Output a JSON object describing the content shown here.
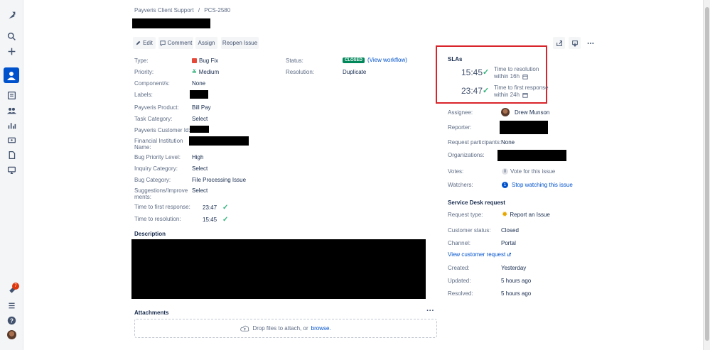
{
  "breadcrumb": {
    "project": "Payveris Client Support",
    "separator": "/",
    "issue_key": "PCS-2580"
  },
  "toolbar": {
    "edit": "Edit",
    "comment": "Comment",
    "assign": "Assign",
    "reopen": "Reopen Issue"
  },
  "details": [
    {
      "label": "Type:",
      "value": "Bug Fix"
    },
    {
      "label": "Priority:",
      "value": "Medium"
    },
    {
      "label": "Component/s:",
      "value": "None"
    },
    {
      "label": "Labels:",
      "value": ""
    },
    {
      "label": "Payveris Product:",
      "value": "Bill Pay"
    },
    {
      "label": "Task Category:",
      "value": "Select"
    },
    {
      "label": "Payveris Customer Id:",
      "value": ""
    },
    {
      "label": "Financial Institution Name:",
      "value": ""
    },
    {
      "label": "Bug Priority Level:",
      "value": "High"
    },
    {
      "label": "Inquiry Category:",
      "value": "Select"
    },
    {
      "label": "Bug Category:",
      "value": "File Processing Issue"
    },
    {
      "label": "Suggestions/Improvements:",
      "value": "Select"
    },
    {
      "label": "Time to first response:",
      "value": "23:47"
    },
    {
      "label": "Time to resolution:",
      "value": "15:45"
    }
  ],
  "status": {
    "label": "Status:",
    "value": "CLOSED",
    "workflow_link": "(View workflow)"
  },
  "resolution": {
    "label": "Resolution:",
    "value": "Duplicate"
  },
  "description_heading": "Description",
  "attachments": {
    "heading": "Attachments",
    "drop_text": "Drop files to attach, or",
    "browse": "browse."
  },
  "slas": {
    "heading": "SLAs",
    "items": [
      {
        "time": "15:45",
        "line1": "Time to resolution",
        "line2": "within 16h"
      },
      {
        "time": "23:47",
        "line1": "Time to first response",
        "line2": "within 24h"
      }
    ]
  },
  "people": {
    "assignee_label": "Assignee:",
    "assignee": "Drew Munson",
    "reporter_label": "Reporter:",
    "participants_label": "Request participants:",
    "participants": "None",
    "organizations_label": "Organizations:",
    "votes_label": "Votes:",
    "votes_count": "0",
    "votes_text": "Vote for this issue",
    "watchers_label": "Watchers:",
    "watchers_count": "1",
    "watchers_text": "Stop watching this issue"
  },
  "service_desk": {
    "heading": "Service Desk request",
    "request_type_label": "Request type:",
    "request_type": "Report an Issue",
    "customer_status_label": "Customer status:",
    "customer_status": "Closed",
    "channel_label": "Channel:",
    "channel": "Portal",
    "view_link": "View customer request"
  },
  "dates": {
    "created_label": "Created:",
    "created": "Yesterday",
    "updated_label": "Updated:",
    "updated": "5 hours ago",
    "resolved_label": "Resolved:",
    "resolved": "5 hours ago"
  },
  "nav": {
    "notification_count": "7"
  },
  "colors": {
    "link": "#0052cc",
    "closed": "#00875a",
    "highlight": "#d9242b",
    "check": "#36b37e"
  }
}
